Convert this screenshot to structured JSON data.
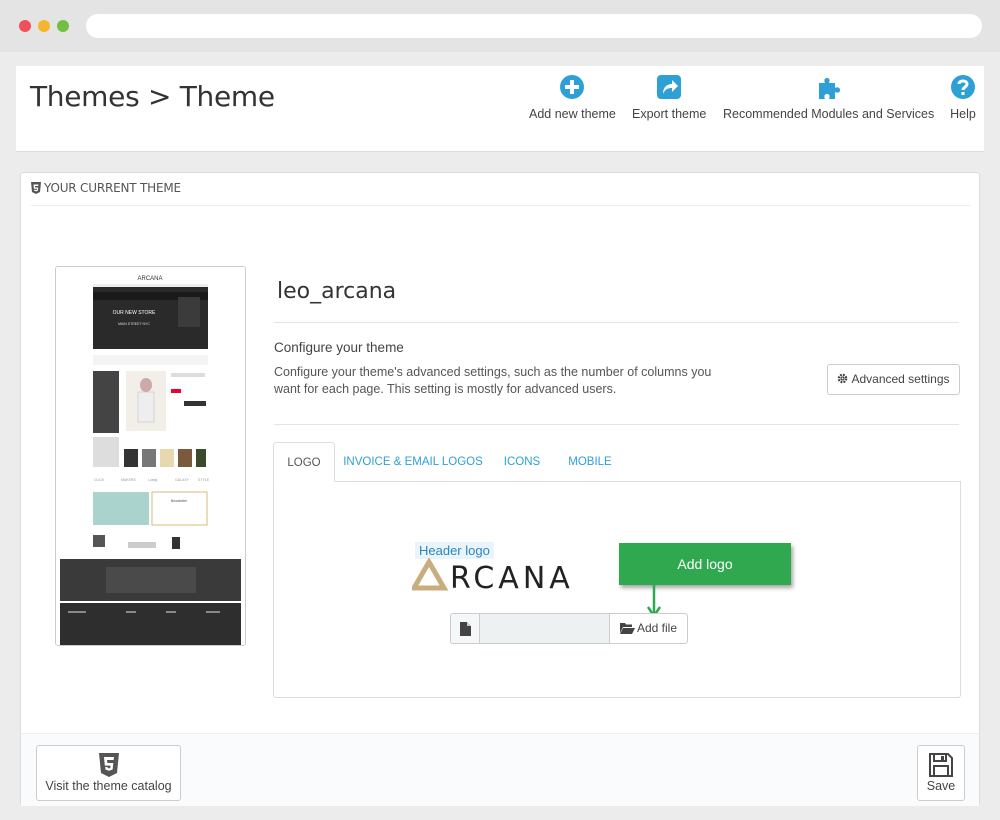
{
  "breadcrumb": {
    "title": "Themes > Theme"
  },
  "toolbar": {
    "items": [
      {
        "label": "Add new theme",
        "icon": "plus-circle-icon"
      },
      {
        "label": "Export theme",
        "icon": "share-icon"
      },
      {
        "label": "Recommended Modules and Services",
        "icon": "puzzle-icon"
      },
      {
        "label": "Help",
        "icon": "help-circle-icon"
      }
    ]
  },
  "panel": {
    "heading": "YOUR CURRENT THEME",
    "theme_name": "leo_arcana",
    "preview": {
      "logo": "ARCANA",
      "banner_line1": "OUR NEW STORE",
      "banner_line2": "MAIN STREET NYC",
      "brands": [
        "CLICK",
        "MAKERS",
        "Lustig",
        "GALAXY",
        "STYLE"
      ],
      "newsletter": "Newsletter"
    },
    "configure": {
      "title": "Configure your theme",
      "description": "Configure your theme's advanced settings, such as the number of columns you want for each page. This setting is mostly for advanced users.",
      "advanced_button": "Advanced settings"
    },
    "tabs": [
      {
        "label": "LOGO",
        "active": true
      },
      {
        "label": "INVOICE & EMAIL LOGOS",
        "active": false
      },
      {
        "label": "ICONS",
        "active": false
      },
      {
        "label": "MOBILE",
        "active": false
      }
    ],
    "logo_tab": {
      "header_logo_label": "Header logo",
      "logo_text": "RCANA",
      "callout": "Add logo",
      "file_value": "",
      "add_file_button": "Add file"
    }
  },
  "footer": {
    "catalog_button": "Visit the theme catalog",
    "save_button": "Save"
  },
  "colors": {
    "accent_blue": "#2ea0d6",
    "callout_green": "#2fa84f",
    "logo_gold": "#c8ad7f"
  }
}
